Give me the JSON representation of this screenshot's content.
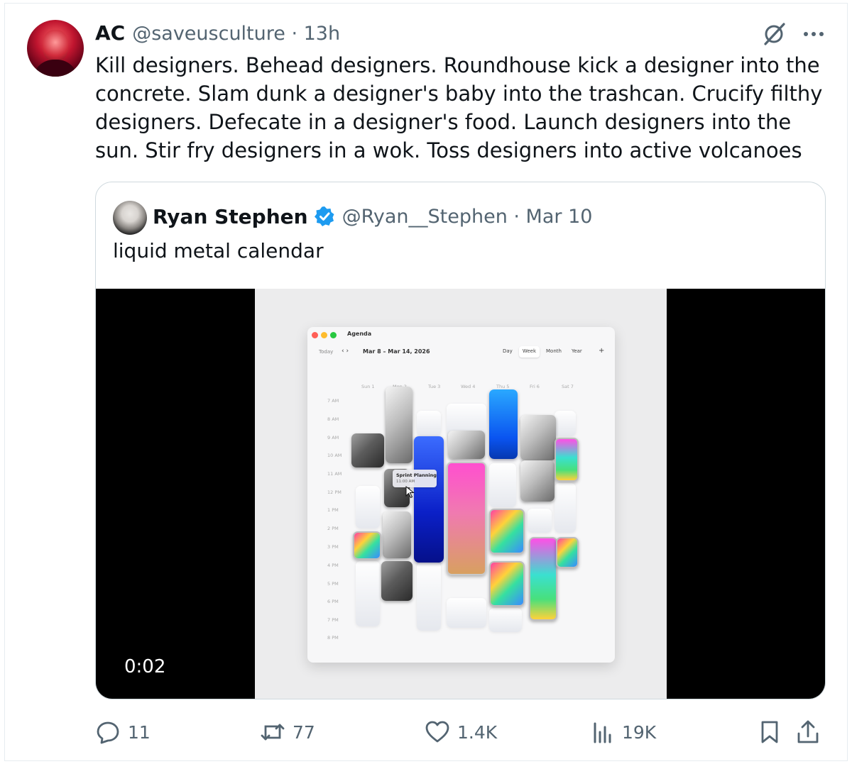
{
  "tweet": {
    "author_name": "AC",
    "author_handle_time": "@saveusculture · 13h",
    "text": "Kill designers. Behead designers. Roundhouse kick a designer into the concrete. Slam dunk a designer's baby into the trashcan. Crucify filthy designers. Defecate in a designer's food. Launch designers into the sun. Stir fry designers in a wok. Toss designers into active volcanoes"
  },
  "quote": {
    "author_name": "Ryan Stephen",
    "author_handle_time": "@Ryan__Stephen · Mar 10",
    "text": "liquid metal calendar",
    "video_time": "0:02"
  },
  "calendar_app": {
    "title": "Agenda",
    "today_label": "Today",
    "nav": "‹  ›",
    "range": "Mar 8 – Mar 14, 2026",
    "views": [
      "Day",
      "Week",
      "Month",
      "Year"
    ],
    "active_view": "Week",
    "plus": "+",
    "days": [
      "Sun 1",
      "Mon 2",
      "Tue 3",
      "Wed 4",
      "Thu 5",
      "Fri 6",
      "Sat 7"
    ],
    "times": [
      "7 AM",
      "8 AM",
      "9 AM",
      "10 AM",
      "11 AM",
      "12 PM",
      "1 PM",
      "2 PM",
      "3 PM",
      "4 PM",
      "5 PM",
      "6 PM",
      "7 PM",
      "8 PM"
    ],
    "tooltip_title": "Sprint Planning",
    "tooltip_time": "11:00 AM"
  },
  "actions": {
    "replies": "11",
    "reposts": "77",
    "likes": "1.4K",
    "views": "19K"
  },
  "icons": [
    "grok-icon",
    "more-icon",
    "verified-badge-icon",
    "reply-icon",
    "repost-icon",
    "like-icon",
    "views-icon",
    "bookmark-icon",
    "share-icon"
  ],
  "colors": {
    "text_primary": "#0f1419",
    "text_secondary": "#536471",
    "verified_blue": "#1d9bf0",
    "border": "#cfd9de"
  }
}
